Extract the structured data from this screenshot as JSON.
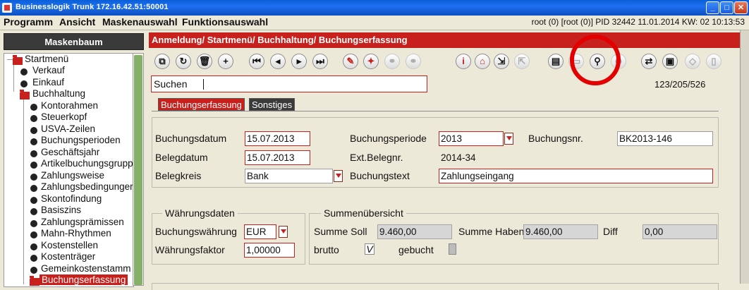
{
  "window": {
    "title": "Businesslogik Trunk 172.16.42.51:50001",
    "buttons": [
      "_",
      "□",
      "✕"
    ]
  },
  "menu": {
    "items": [
      "Programm",
      "Ansicht",
      "Maskenauswahl",
      "Funktionsauswahl"
    ],
    "status": "root (0) [root (0)] PID 32442 11.01.2014 KW: 02 10:13:53"
  },
  "sidebar": {
    "header": "Maskenbaum",
    "root": "Startmenü",
    "items": [
      {
        "label": "Verkauf",
        "type": "leaf"
      },
      {
        "label": "Einkauf",
        "type": "leaf"
      },
      {
        "label": "Buchhaltung",
        "type": "folder"
      },
      {
        "label": "Kontorahmen",
        "type": "leaf"
      },
      {
        "label": "Steuerkopf",
        "type": "leaf"
      },
      {
        "label": "USVA-Zeilen",
        "type": "leaf"
      },
      {
        "label": "Buchungsperioden",
        "type": "leaf"
      },
      {
        "label": "Geschäftsjahr",
        "type": "leaf"
      },
      {
        "label": "Artikelbuchungsgrupp",
        "type": "leaf"
      },
      {
        "label": "Zahlungsweise",
        "type": "leaf"
      },
      {
        "label": "Zahlungsbedingunger",
        "type": "leaf"
      },
      {
        "label": "Skontofindung",
        "type": "leaf"
      },
      {
        "label": "Basiszins",
        "type": "leaf"
      },
      {
        "label": "Zahlungsprämissen",
        "type": "leaf"
      },
      {
        "label": "Mahn-Rhythmen",
        "type": "leaf"
      },
      {
        "label": "Kostenstellen",
        "type": "leaf"
      },
      {
        "label": "Kostenträger",
        "type": "leaf"
      },
      {
        "label": "Gemeinkostenstamm",
        "type": "leaf"
      },
      {
        "label": "Buchungserfassung",
        "type": "selected"
      }
    ]
  },
  "breadcrumb": "Anmeldung/ Startmenü/ Buchhaltung/ Buchungserfassung",
  "toolbar": {
    "icons": [
      "window-icon",
      "refresh-icon",
      "trash-icon",
      "plus-icon",
      "first-icon",
      "prev-icon",
      "next-icon",
      "last-icon",
      "edit-icon",
      "pin-icon",
      "link-a-icon",
      "link-b-icon",
      "info-icon",
      "home-icon",
      "import-icon",
      "export-icon",
      "document-icon",
      "blank-icon",
      "search-icon",
      "zoom-icon",
      "swap-icon",
      "print-icon",
      "tag-icon",
      "file-icon"
    ]
  },
  "search": {
    "label": "Suchen",
    "counter": "123/205/526"
  },
  "tabs": [
    "Buchungserfassung",
    "Sonstiges"
  ],
  "form": {
    "buchungsdatum": {
      "label": "Buchungsdatum",
      "value": "15.07.2013"
    },
    "belegdatum": {
      "label": "Belegdatum",
      "value": "15.07.2013"
    },
    "belegkreis": {
      "label": "Belegkreis",
      "value": "Bank"
    },
    "buchungsperiode": {
      "label": "Buchungsperiode",
      "value": "2013"
    },
    "ext_belegnr": {
      "label": "Ext.Belegnr.",
      "value": "2014-34"
    },
    "buchungstext": {
      "label": "Buchungstext",
      "value": "Zahlungseingang"
    },
    "buchungsnr": {
      "label": "Buchungsnr.",
      "value": "BK2013-146"
    }
  },
  "waehrung": {
    "legend": "Währungsdaten",
    "buchungswaehrung": {
      "label": "Buchungswährung",
      "value": "EUR"
    },
    "waehrungsfaktor": {
      "label": "Währungsfaktor",
      "value": "1,00000"
    }
  },
  "summen": {
    "legend": "Summenübersicht",
    "soll": {
      "label": "Summe Soll",
      "value": "9.460,00"
    },
    "haben": {
      "label": "Summe Haben",
      "value": "9.460,00"
    },
    "diff": {
      "label": "Diff",
      "value": "0,00"
    },
    "brutto": {
      "label": "brutto",
      "checked": "V"
    },
    "gebucht": {
      "label": "gebucht"
    }
  },
  "colors": {
    "accent": "#c8201c",
    "background": "#ece9d8",
    "highlight_circle": "#e30000"
  }
}
